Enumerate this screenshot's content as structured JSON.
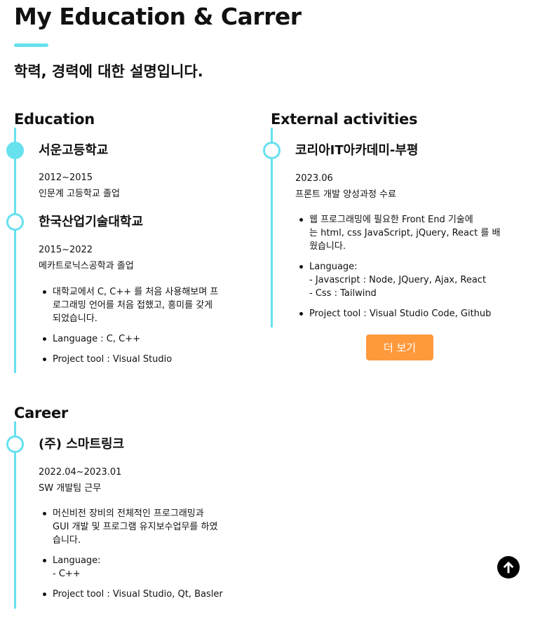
{
  "header": {
    "title": "My Education & Carrer",
    "subtitle": "학력, 경력에 대한 설명입니다."
  },
  "education": {
    "title": "Education",
    "items": [
      {
        "name": "서운고등학교",
        "period": "2012~2015",
        "desc": "인문계 고등학교 졸업",
        "bullets": []
      },
      {
        "name": "한국산업기술대학교",
        "period": "2015~2022",
        "desc": "메카트로닉스공학과 졸업",
        "bullets": [
          [
            "대학교에서 C, C++ 를 처음 사용해보며 프",
            "로그래밍 언어를 처음 접했고, 흥미를 갖게",
            "되었습니다."
          ],
          [
            "Language : C, C++"
          ],
          [
            "Project tool : Visual Studio"
          ]
        ]
      }
    ]
  },
  "external": {
    "title": "External activities",
    "items": [
      {
        "name": "코리아IT아카데미-부평",
        "period": "2023.06",
        "desc": "프론트 개발 양성과정 수료",
        "bullets": [
          [
            "웹 프로그래밍에 필요한 Front End 기술에",
            "는 html, css JavaScript, jQuery, React 를 배",
            "웠습니다."
          ],
          [
            "Language:",
            "- Javascript : Node, JQuery, Ajax, React",
            "- Css : Tailwind"
          ],
          [
            "Project tool : Visual Studio Code, Github"
          ]
        ]
      }
    ],
    "more_label": "더 보기"
  },
  "career": {
    "title": "Career",
    "items": [
      {
        "name": "(주) 스마트링크",
        "period": "2022.04~2023.01",
        "desc": "SW 개발팀 근무",
        "bullets": [
          [
            "머신비전 장비의 전체적인 프로그래밍과",
            "GUI 개발 및 프로그램 유지보수업무를 하였",
            "습니다."
          ],
          [
            "Language:",
            "- C++"
          ],
          [
            "Project tool : Visual Studio, Qt, Basler"
          ]
        ]
      }
    ]
  },
  "icons": {
    "scroll_top": "arrow-up-circle-icon"
  },
  "colors": {
    "accent": "#67e1ee",
    "button": "#ff9a3c",
    "text": "#111111"
  }
}
